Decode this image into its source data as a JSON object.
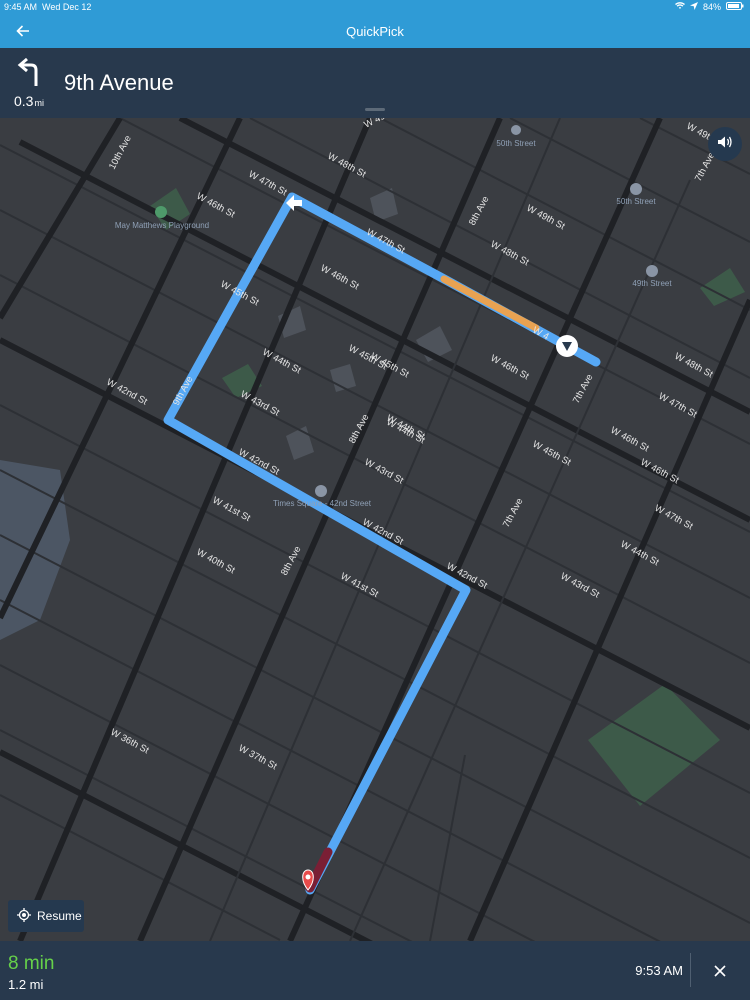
{
  "status_bar": {
    "time": "9:45 AM",
    "date": "Wed Dec 12",
    "battery": "84%",
    "icons": [
      "wifi-icon",
      "location-arrow-icon",
      "battery-icon"
    ]
  },
  "app_bar": {
    "title": "QuickPick",
    "back_icon": "back-arrow-icon"
  },
  "navigation": {
    "turn_icon": "turn-left-icon",
    "distance": "0.3",
    "distance_unit": "mi",
    "street": "9th Avenue"
  },
  "map": {
    "street_labels": [
      "W 49th St",
      "W 48th St",
      "W 47th St",
      "W 46th St",
      "W 45th St",
      "W 44th St",
      "W 43rd St",
      "W 42nd St",
      "W 41st St",
      "W 40th St",
      "W 37th St",
      "W 36th St",
      "10th Ave",
      "9th Ave",
      "8th Ave",
      "7th Ave",
      "W 47th St",
      "W 46th St",
      "W 45th St",
      "W 44th St",
      "W 43rd St",
      "W 42nd St",
      "W 42nd St",
      "W 42nd St",
      "W 48th St",
      "W 49th St",
      "W 47th St",
      "W 46th St",
      "W 45th St",
      "W 44th St",
      "W 43rd St",
      "W 46th St",
      "W 45th St",
      "W 44th St",
      "W 41st St",
      "8th Ave",
      "7th Ave",
      "W 48th St",
      "W 46th St",
      "W 47th St",
      "W 49th St",
      "8th Ave",
      "7th Ave",
      "W 4"
    ],
    "poi_labels": [
      "May Matthews Playground",
      "50th Street",
      "50th Street",
      "49th Street",
      "Times Square - 42nd Street"
    ],
    "route_color": "#56a8f5",
    "traffic_color": "#e8a252",
    "congestion_color": "#7a1f35"
  },
  "controls": {
    "volume_icon": "volume-icon",
    "resume_label": "Resume",
    "resume_icon": "recenter-icon"
  },
  "trip": {
    "duration": "8 min",
    "distance": "1.2 mi",
    "arrival": "9:53 AM",
    "close_icon": "close-icon"
  }
}
